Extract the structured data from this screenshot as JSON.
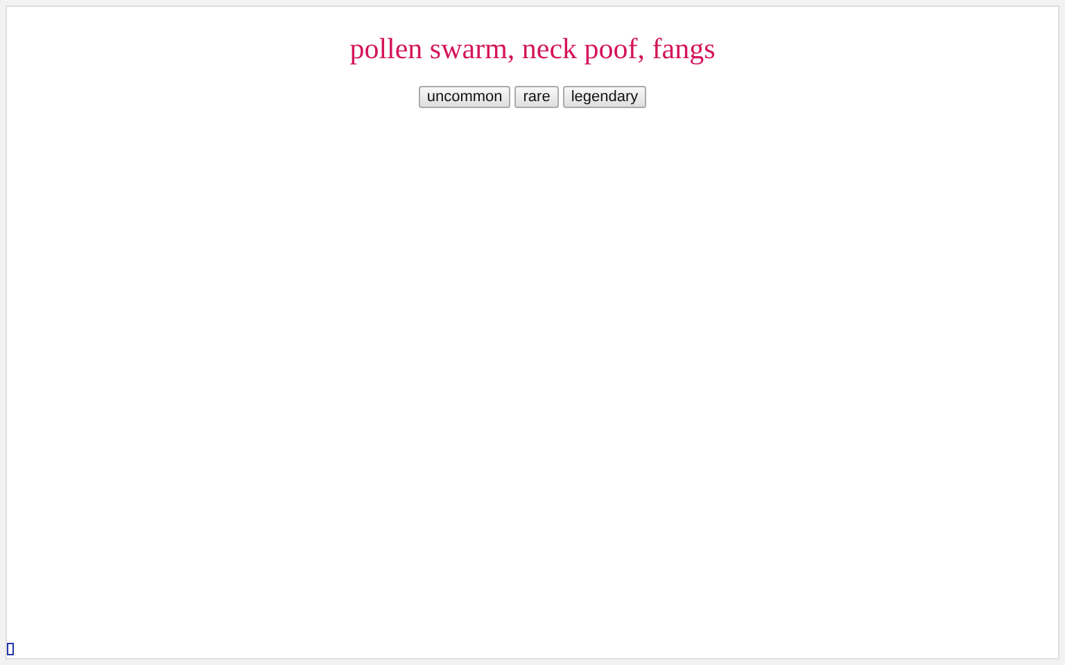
{
  "title": "pollen swarm, neck poof, fangs",
  "buttons": [
    "uncommon",
    "rare",
    "legendary"
  ]
}
